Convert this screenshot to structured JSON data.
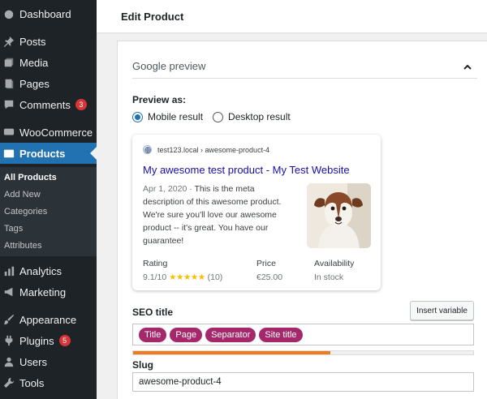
{
  "sidebar": {
    "items": [
      {
        "label": "Dashboard",
        "icon": "dashboard-icon"
      },
      {
        "label": "Posts",
        "icon": "pin-icon"
      },
      {
        "label": "Media",
        "icon": "media-icon"
      },
      {
        "label": "Pages",
        "icon": "pages-icon"
      },
      {
        "label": "Comments",
        "icon": "comment-icon",
        "badge": "3"
      },
      {
        "label": "WooCommerce",
        "icon": "woocommerce-icon"
      },
      {
        "label": "Products",
        "icon": "products-icon"
      },
      {
        "label": "Analytics",
        "icon": "analytics-icon"
      },
      {
        "label": "Marketing",
        "icon": "megaphone-icon"
      },
      {
        "label": "Appearance",
        "icon": "brush-icon"
      },
      {
        "label": "Plugins",
        "icon": "plugin-icon",
        "badge": "5"
      },
      {
        "label": "Users",
        "icon": "users-icon"
      },
      {
        "label": "Tools",
        "icon": "wrench-icon"
      }
    ],
    "submenu": [
      "All Products",
      "Add New",
      "Categories",
      "Tags",
      "Attributes"
    ]
  },
  "topbar": {
    "title": "Edit Product"
  },
  "panel": {
    "heading": "Google preview",
    "preview_as_label": "Preview as:",
    "option_mobile": "Mobile result",
    "option_desktop": "Desktop result"
  },
  "card": {
    "url": "test123.local › awesome-product-4",
    "link": "My awesome test product - My Test Website",
    "date": "Apr 1, 2020",
    "date_sep": " · ",
    "description": "This is the meta description of this awesome product. We're sure you'll love our awesome product -- it's great. You have our guarantee!",
    "rating_label": "Rating",
    "rating_value": "9.1/10",
    "stars": "★★★★★",
    "rating_count": "(10)",
    "price_label": "Price",
    "price_value": "€25.00",
    "availability_label": "Availability",
    "availability_value": "In stock"
  },
  "seo": {
    "title_label": "SEO title",
    "insert_variable": "Insert variable",
    "tags": [
      "Title",
      "Page",
      "Separator",
      "Site title"
    ],
    "progress": 0.58,
    "slug_label": "Slug",
    "slug_value": "awesome-product-4"
  },
  "colors": {
    "sidebar_bg": "#1d2327",
    "accent": "#2271b1",
    "tag": "#a4286a",
    "progress": "#ee7c1b",
    "link": "#1a0dab"
  }
}
